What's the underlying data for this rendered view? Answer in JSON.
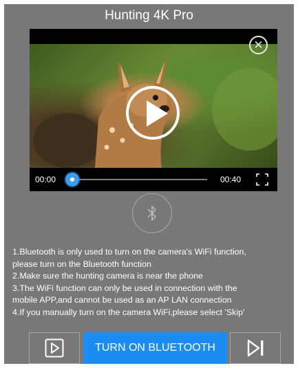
{
  "header": {
    "title": "Hunting 4K Pro"
  },
  "video": {
    "current_time": "00:00",
    "duration": "00:40",
    "progress": 0
  },
  "instructions": {
    "lines": [
      "1.Bluetooth is only used to turn on the camera's WiFi function,",
      "please turn on the Bluetooth function",
      "2.Make sure the hunting camera is near the phone",
      "3.The WiFi function can only be used in connection with the",
      "mobile APP,and cannot be used as an AP LAN connection",
      "4.If you manually turn on the camera WiFi,please select 'Skip'"
    ]
  },
  "actions": {
    "turn_on_bluetooth_label": "TURN ON BLUETOOTH"
  },
  "icons": {
    "close": "close-icon",
    "play": "play-icon",
    "fullscreen": "fullscreen-icon",
    "bluetooth": "bluetooth-icon",
    "video_tutorial": "play-outline-icon",
    "skip": "skip-next-icon"
  },
  "colors": {
    "background": "#787878",
    "accent": "#1a8cf2",
    "progress": "#3d9be8"
  }
}
